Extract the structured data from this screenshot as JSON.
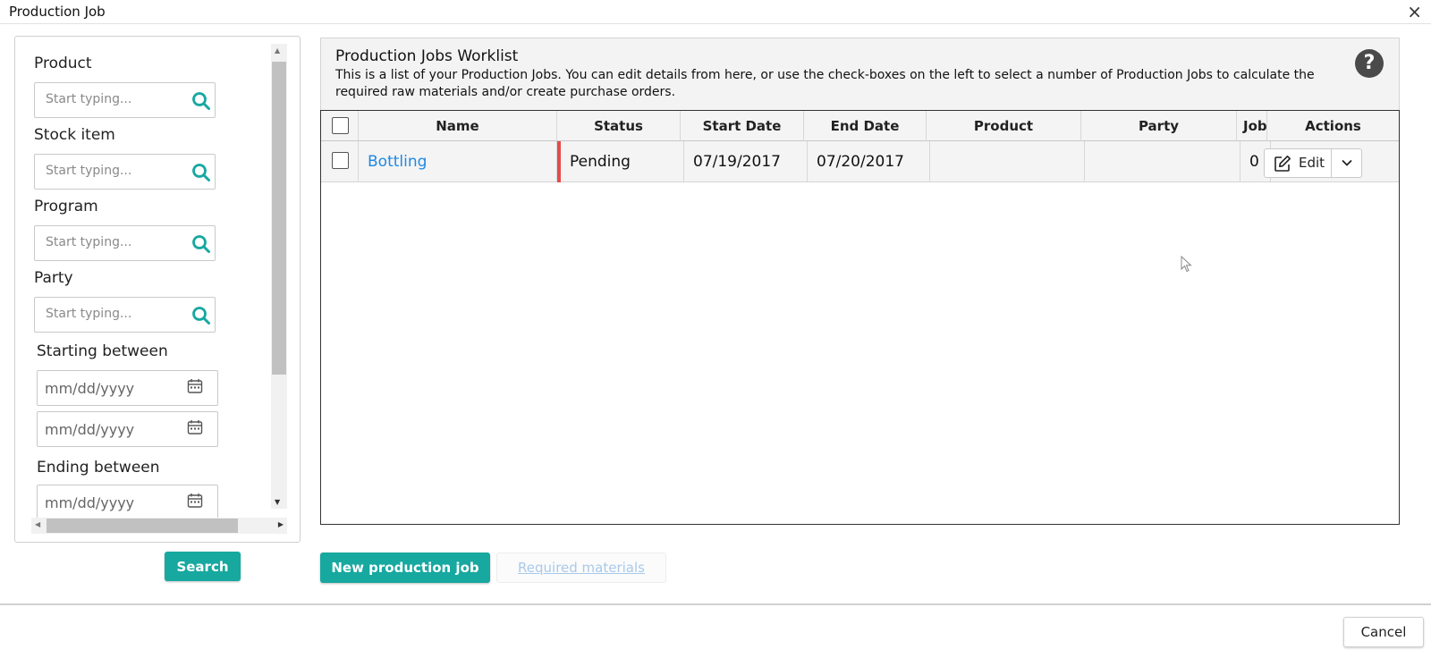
{
  "window": {
    "title": "Production Job",
    "close_icon": "×"
  },
  "filters": {
    "product": {
      "label": "Product",
      "placeholder": "Start typing..."
    },
    "stock_item": {
      "label": "Stock item",
      "placeholder": "Start typing..."
    },
    "program": {
      "label": "Program",
      "placeholder": "Start typing..."
    },
    "party": {
      "label": "Party",
      "placeholder": "Start typing..."
    },
    "starting_between": {
      "label": "Starting between",
      "from_placeholder": "mm/dd/yyyy",
      "to_placeholder": "mm/dd/yyyy"
    },
    "ending_between": {
      "label": "Ending between",
      "from_placeholder": "mm/dd/yyyy"
    },
    "search_label": "Search"
  },
  "worklist": {
    "title": "Production Jobs Worklist",
    "description": "This is a list of your Production Jobs. You can edit details from here, or use the check-boxes on the left to select a number of Production Jobs to calculate the required raw materials and/or create purchase orders.",
    "help_icon": "?",
    "columns": [
      "Name",
      "Status",
      "Start Date",
      "End Date",
      "Product",
      "Party",
      "Job",
      "Actions"
    ],
    "rows": [
      {
        "name": "Bottling",
        "status": "Pending",
        "start_date": "07/19/2017",
        "end_date": "07/20/2017",
        "product": "",
        "party": "",
        "job": "0",
        "edit_label": "Edit"
      }
    ],
    "status_color": "#e54b4b"
  },
  "buttons": {
    "new_job": "New production job",
    "required_materials": "Required materials",
    "cancel": "Cancel"
  },
  "colors": {
    "accent": "#17a8a0",
    "link": "#1e88e5"
  }
}
